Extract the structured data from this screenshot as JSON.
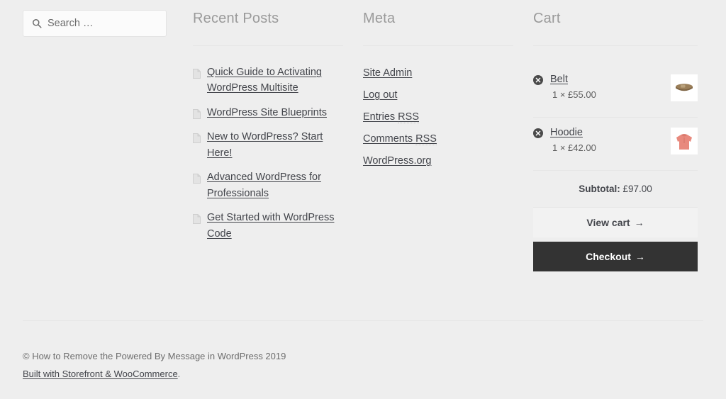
{
  "colors": {
    "page_background": "#eeeeee",
    "text": "#43454b",
    "muted_title": "#9a9a9a",
    "rule": "#e6e6e6",
    "checkout_button_bg": "#333333",
    "view_cart_button_bg": "#f2f2f2",
    "belt_thumb": "#8a6f4e",
    "hoodie_thumb": "#e8897d"
  },
  "search": {
    "placeholder": "Search …",
    "value": "",
    "icon": "search-icon"
  },
  "recent_posts": {
    "title": "Recent Posts",
    "item_icon": "document-icon",
    "items": [
      {
        "label": "Quick Guide to Activating WordPress Multisite"
      },
      {
        "label": "WordPress Site Blueprints"
      },
      {
        "label": "New to WordPress? Start Here!"
      },
      {
        "label": "Advanced WordPress for Professionals"
      },
      {
        "label": "Get Started with WordPress Code"
      }
    ]
  },
  "meta": {
    "title": "Meta",
    "items": [
      {
        "label": "Site Admin",
        "abbr": ""
      },
      {
        "label": "Log out",
        "abbr": ""
      },
      {
        "label": "Entries ",
        "abbr": "RSS"
      },
      {
        "label": "Comments ",
        "abbr": "RSS"
      },
      {
        "label": "WordPress.org",
        "abbr": ""
      }
    ]
  },
  "cart": {
    "title": "Cart",
    "remove_icon": "remove-circle-icon",
    "items": [
      {
        "name": "Belt",
        "quantity_price": "1 × £55.00",
        "thumb_icon": "belt-thumbnail"
      },
      {
        "name": "Hoodie",
        "quantity_price": "1 × £42.00",
        "thumb_icon": "hoodie-thumbnail"
      }
    ],
    "subtotal_label": "Subtotal:",
    "subtotal_value": "£97.00",
    "view_cart_label": "View cart",
    "checkout_label": "Checkout",
    "button_arrow": "→"
  },
  "footer": {
    "copyright": "© How to Remove the Powered By Message in WordPress 2019",
    "credit_link": "Built with Storefront & WooCommerce",
    "credit_suffix": "."
  }
}
